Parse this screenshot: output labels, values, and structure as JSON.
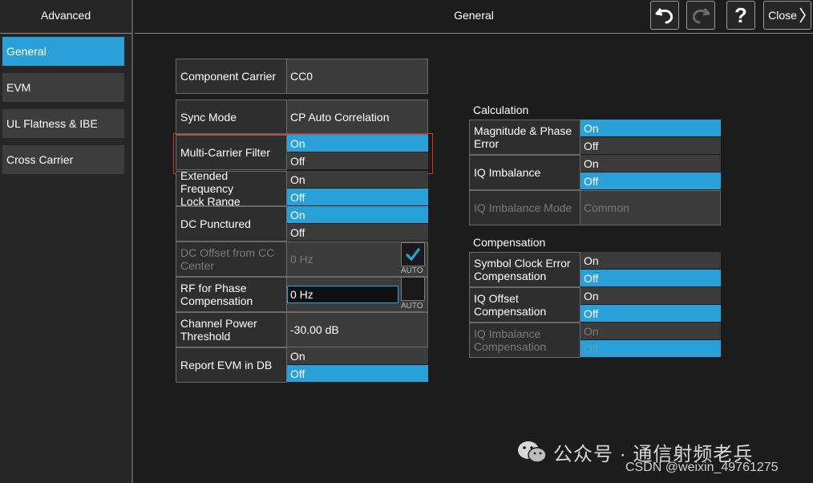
{
  "sidebar": {
    "title": "Advanced",
    "items": [
      {
        "label": "General",
        "active": true
      },
      {
        "label": "EVM",
        "active": false
      },
      {
        "label": "UL Flatness & IBE",
        "active": false
      },
      {
        "label": "Cross Carrier",
        "active": false
      }
    ]
  },
  "header": {
    "title": "General",
    "close_label": "Close",
    "help_label": "?"
  },
  "settings": {
    "component_carrier": {
      "label": "Component Carrier",
      "value": "CC0"
    },
    "sync_mode": {
      "label": "Sync Mode",
      "value": "CP Auto Correlation"
    },
    "multi_carrier_filter": {
      "label": "Multi-Carrier Filter",
      "on": "On",
      "off": "Off",
      "selected": "On"
    },
    "extended_freq_lock": {
      "label_line1": "Extended Frequency",
      "label_line2": "Lock Range",
      "on": "On",
      "off": "Off",
      "selected": "Off"
    },
    "dc_punctured": {
      "label": "DC Punctured",
      "on": "On",
      "off": "Off",
      "selected": "On"
    },
    "dc_offset": {
      "label_line1": "DC Offset from CC",
      "label_line2": "Center",
      "value": "0 Hz",
      "auto": "AUTO",
      "auto_checked": true
    },
    "rf_phase_comp": {
      "label_line1": "RF for Phase",
      "label_line2": "Compensation",
      "value": "0 Hz",
      "auto": "AUTO",
      "auto_checked": false
    },
    "channel_power_threshold": {
      "label_line1": "Channel Power",
      "label_line2": "Threshold",
      "value": "-30.00 dB"
    },
    "report_evm_db": {
      "label": "Report EVM in DB",
      "on": "On",
      "off": "Off",
      "selected": "Off"
    }
  },
  "calculation": {
    "title": "Calculation",
    "mag_phase_error": {
      "label_line1": "Magnitude & Phase",
      "label_line2": "Error",
      "on": "On",
      "off": "Off",
      "selected": "On"
    },
    "iq_imbalance": {
      "label": "IQ Imbalance",
      "on": "On",
      "off": "Off",
      "selected": "Off"
    },
    "iq_imbalance_mode": {
      "label": "IQ Imbalance Mode",
      "value": "Common"
    }
  },
  "compensation": {
    "title": "Compensation",
    "symbol_clock_error": {
      "label_line1": "Symbol Clock Error",
      "label_line2": "Compensation",
      "on": "On",
      "off": "Off",
      "selected": "Off"
    },
    "iq_offset": {
      "label_line1": "IQ Offset",
      "label_line2": "Compensation",
      "on": "On",
      "off": "Off",
      "selected": "Off"
    },
    "iq_imbalance_comp": {
      "label_line1": "IQ Imbalance",
      "label_line2": "Compensation",
      "on": "On",
      "off": "Off",
      "selected": "Off"
    }
  },
  "watermark": {
    "text": "公众号 · 通信射频老兵",
    "csdn": "CSDN @weixin_49761275"
  },
  "colors": {
    "accent": "#2aa0d8",
    "highlight": "#d43434"
  }
}
